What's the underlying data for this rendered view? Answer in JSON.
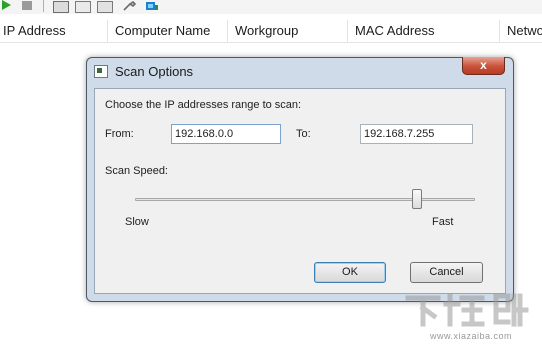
{
  "toolbar": {
    "icons": [
      "play-icon",
      "stop-icon",
      "save-icon",
      "copy-icon",
      "paste-icon",
      "wrench-icon",
      "scan-icon"
    ],
    "colors": {
      "play": "#2aa22a",
      "scan": "#1c7fd0"
    }
  },
  "table": {
    "columns": [
      "IP Address",
      "Computer Name",
      "Workgroup",
      "MAC Address",
      "Network"
    ]
  },
  "dialog": {
    "title": "Scan Options",
    "close_label": "x",
    "range_label": "Choose the IP addresses range to scan:",
    "from_label": "From:",
    "from_value": "192.168.0.0",
    "to_label": "To:",
    "to_value": "192.168.7.255",
    "speed_label": "Scan Speed:",
    "speed_level": 0.83,
    "slow_label": "Slow",
    "fast_label": "Fast",
    "ok_label": "OK",
    "cancel_label": "Cancel"
  },
  "watermark": {
    "logo": "下载吧",
    "url": "www.xiazaiba.com"
  }
}
